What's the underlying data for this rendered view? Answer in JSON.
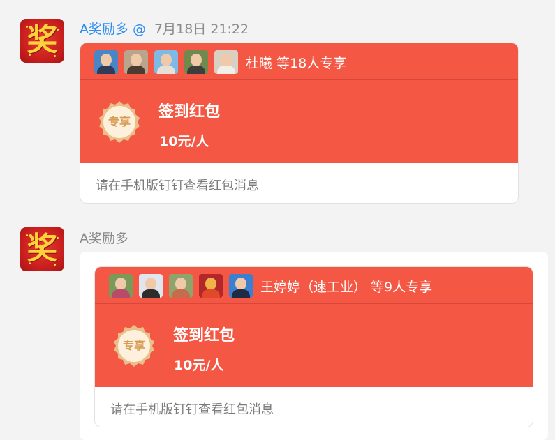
{
  "messages": [
    {
      "avatar_char": "奖",
      "sender": "A奖励多 @",
      "timestamp": "7月18日 21:22",
      "recipients_text": "杜曦 等18人专享",
      "badge": "专享",
      "title": "签到红包",
      "amount": "10元/人",
      "footer": "请在手机版钉钉查看红包消息"
    },
    {
      "avatar_char": "奖",
      "sender": "A奖励多",
      "recipients_text": "王婷婷（速工业） 等9人专享",
      "badge": "专享",
      "title": "签到红包",
      "amount": "10元/人",
      "footer": "请在手机版钉钉查看红包消息"
    }
  ],
  "colors": {
    "red_packet": "#f45744",
    "link_blue": "#2d8cf0",
    "badge_gold": "#e9c08a"
  }
}
